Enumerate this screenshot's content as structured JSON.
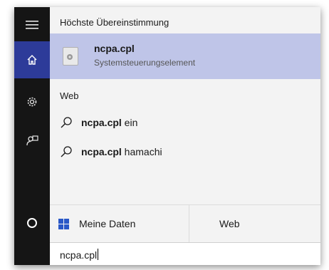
{
  "rail": {
    "items": [
      {
        "icon": "hamburger-menu-icon"
      },
      {
        "icon": "home-icon",
        "active": true
      },
      {
        "icon": "gear-icon"
      },
      {
        "icon": "feedback-icon"
      },
      {
        "icon": "cortana-circle-icon"
      }
    ]
  },
  "best_match": {
    "header": "Höchste Übereinstimmung",
    "title": "ncpa.cpl",
    "subtitle": "Systemsteuerungselement"
  },
  "web": {
    "header": "Web",
    "results": [
      {
        "bold": "ncpa.cpl",
        "rest": " ein"
      },
      {
        "bold": "ncpa.cpl",
        "rest": " hamachi"
      }
    ]
  },
  "bottom_tabs": {
    "left_label": "Meine Daten",
    "right_label": "Web"
  },
  "search": {
    "value": "ncpa.cpl"
  }
}
